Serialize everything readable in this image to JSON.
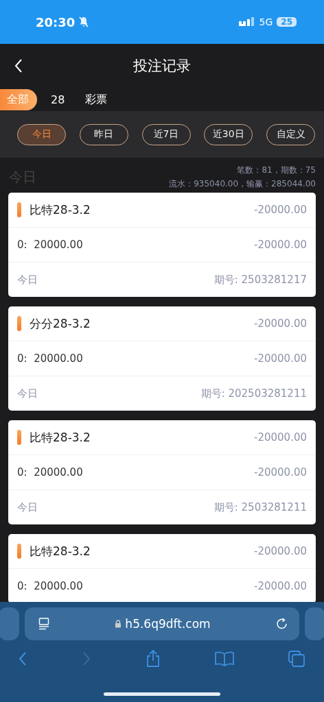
{
  "status_bar": {
    "time": "20:30",
    "network": "5G",
    "battery": "25"
  },
  "header": {
    "title": "投注记录"
  },
  "categories": [
    {
      "label": "全部",
      "selected": true
    },
    {
      "label": "28",
      "selected": false
    },
    {
      "label": "彩票",
      "selected": false
    }
  ],
  "date_filters": [
    {
      "label": "今日",
      "selected": true
    },
    {
      "label": "昨日",
      "selected": false
    },
    {
      "label": "近7日",
      "selected": false
    },
    {
      "label": "近30日",
      "selected": false
    },
    {
      "label": "自定义",
      "selected": false
    }
  ],
  "summary": {
    "period": "今日",
    "counts": "笔数：81，期数：75",
    "totals": "流水：935040.00，输赢：285044.00"
  },
  "records": [
    {
      "game": "比特28-3.2",
      "result": "-20000.00",
      "bet": "0:  20000.00",
      "bet_result": "-20000.00",
      "date": "今日",
      "issue": "期号: 2503281217"
    },
    {
      "game": "分分28-3.2",
      "result": "-20000.00",
      "bet": "0:  20000.00",
      "bet_result": "-20000.00",
      "date": "今日",
      "issue": "期号: 202503281211"
    },
    {
      "game": "比特28-3.2",
      "result": "-20000.00",
      "bet": "0:  20000.00",
      "bet_result": "-20000.00",
      "date": "今日",
      "issue": "期号: 2503281211"
    },
    {
      "game": "比特28-3.2",
      "result": "-20000.00",
      "bet": "0:  20000.00",
      "bet_result": "-20000.00"
    }
  ],
  "browser": {
    "url": "h5.6q9dft.com",
    "back_disabled": false,
    "forward_disabled": true
  }
}
